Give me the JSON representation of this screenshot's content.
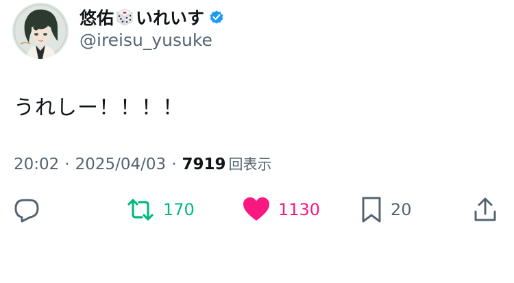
{
  "author": {
    "display_name_prefix": "悠佑",
    "display_name_suffix": "いれいす",
    "name_emoji_icon": "game-die-icon",
    "verified_icon": "verified-badge-icon",
    "handle": "@ireisu_yusuke"
  },
  "tweet": {
    "text": "うれしー！！！！",
    "time": "20:02",
    "separator": "·",
    "date": "2025/04/03",
    "views_count": "7919",
    "views_label": "回表示"
  },
  "actions": {
    "reply": {
      "icon": "reply-icon"
    },
    "retweet": {
      "icon": "retweet-icon",
      "count": "170"
    },
    "like": {
      "icon": "heart-icon",
      "count": "1130"
    },
    "bookmark": {
      "icon": "bookmark-icon",
      "count": "20"
    },
    "share": {
      "icon": "share-icon"
    }
  },
  "colors": {
    "text_primary": "#0f1419",
    "text_secondary": "#536471",
    "verified_blue": "#1d9bf0",
    "retweet_green": "#00ba7c",
    "like_pink": "#f91880"
  }
}
